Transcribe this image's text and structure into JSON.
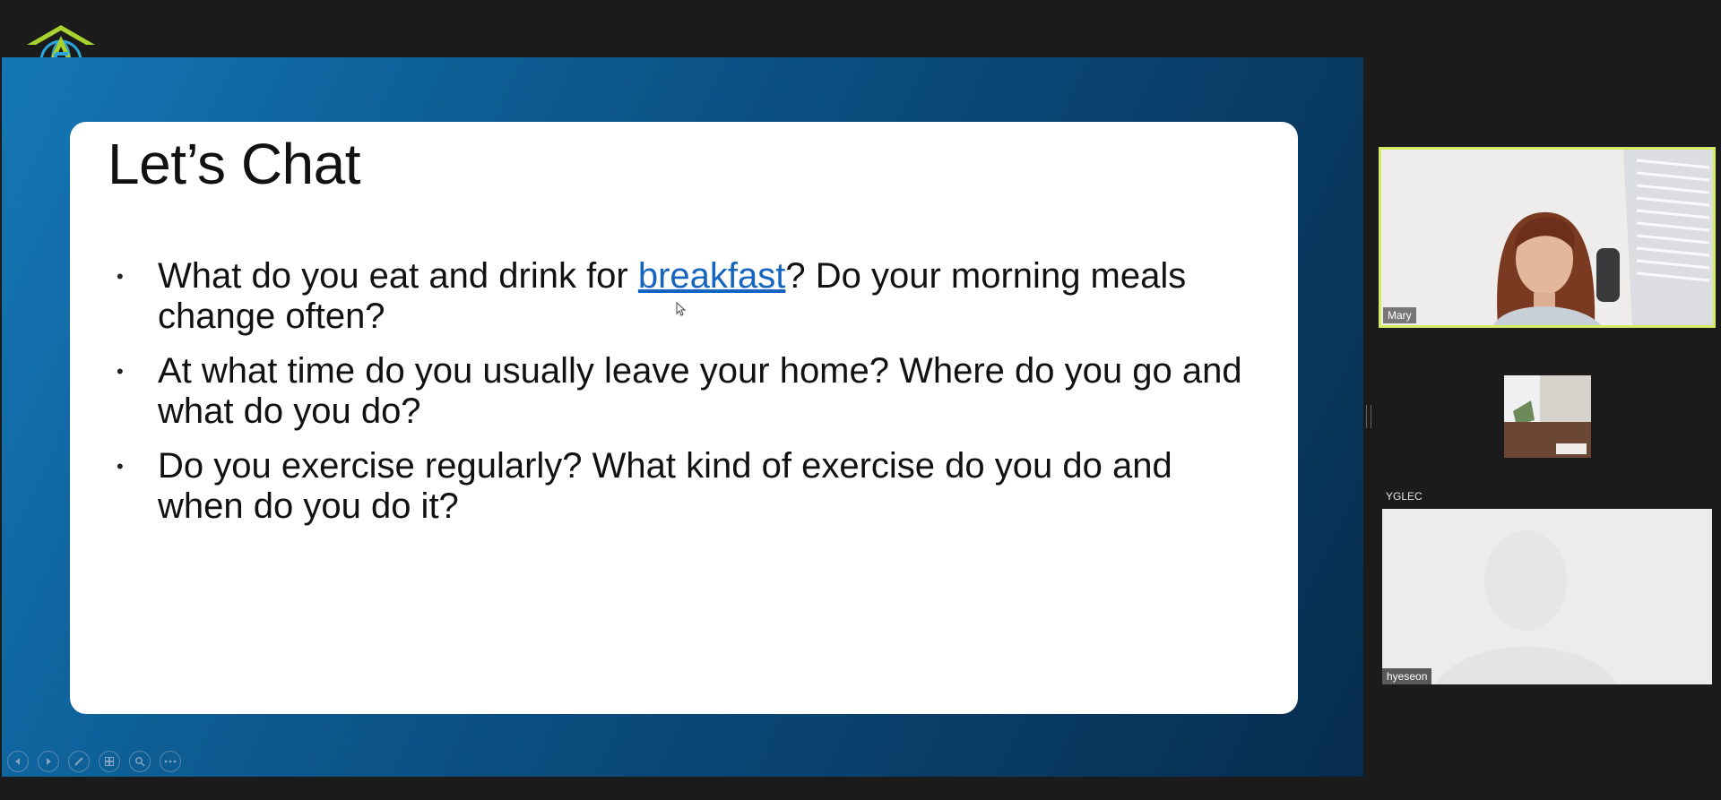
{
  "slide": {
    "title": "Let’s Chat",
    "bullets": [
      {
        "before": "What do you eat and drink for ",
        "link": "breakfast",
        "after": "? Do your morning meals change often?"
      },
      {
        "text": "At what time do you usually leave your home? Where do you go and what do you do?"
      },
      {
        "text": "Do you exercise regularly? What kind of exercise do you do and when do you do it?"
      }
    ],
    "bullet_glyph": "•"
  },
  "slide_toolbar": {
    "icons": [
      "previous-slide-icon",
      "next-slide-icon",
      "pen-icon",
      "slides-grid-icon",
      "zoom-icon",
      "more-options-icon"
    ]
  },
  "participants": [
    {
      "name": "Mary",
      "active_speaker": true,
      "accent": "#d4ec63"
    },
    {
      "name": "YGLEC"
    },
    {
      "name": "hyeseon"
    }
  ],
  "colors": {
    "background": "#1b1b1b",
    "slide_gradient_start": "#1577b6",
    "slide_gradient_end": "#072d4d",
    "link": "#1565c0",
    "logo_green": "#a8d22f",
    "logo_blue": "#2aa7dc"
  }
}
